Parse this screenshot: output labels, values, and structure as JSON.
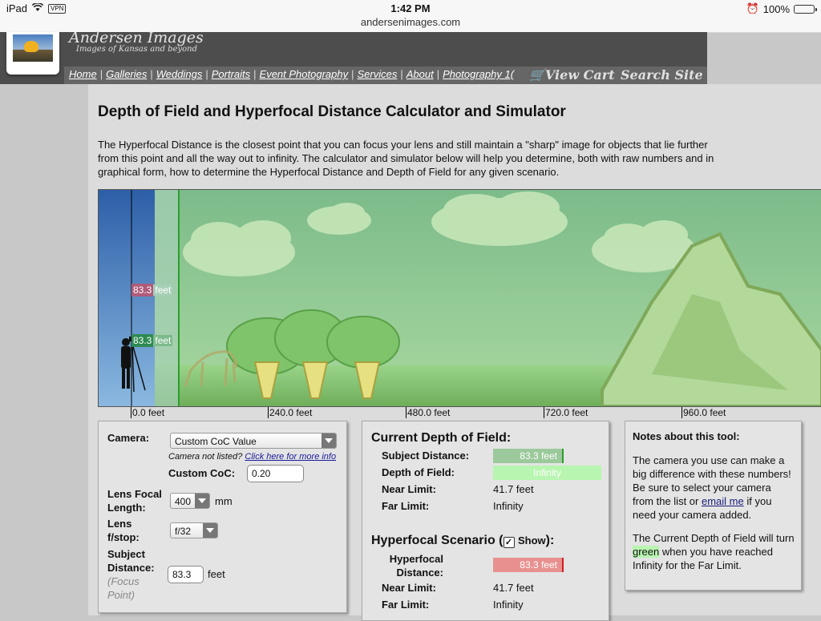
{
  "status_bar": {
    "device": "iPad",
    "vpn": "VPN",
    "time": "1:42 PM",
    "url": "andersenimages.com",
    "battery": "100%"
  },
  "header": {
    "site_title": "Andersen Images",
    "tagline": "Images of Kansas and beyond",
    "nav": [
      "Home",
      "Galleries",
      "Weddings",
      "Portraits",
      "Event Photography",
      "Services",
      "About",
      "Photography 1("
    ],
    "view_cart": "View Cart",
    "search_site": "Search Site"
  },
  "page": {
    "title": "Depth of Field and Hyperfocal Distance Calculator and Simulator",
    "intro": "The Hyperfocal Distance is the closest point that you can focus your lens and still maintain a \"sharp\" image for objects that lie further from this point and all the way out to infinity. The calculator and simulator below will help you determine, both with raw numbers and in graphical form, how to determine the Hyperfocal Distance and Depth of Field for any given scenario."
  },
  "simulator": {
    "hyperfocal_label": {
      "value": "83.3",
      "unit": "feet"
    },
    "subject_label": {
      "value": "83.3",
      "unit": "feet"
    },
    "ticks": [
      "0.0 feet",
      "240.0 feet",
      "480.0 feet",
      "720.0 feet",
      "960.0 feet"
    ]
  },
  "camera_panel": {
    "camera_label": "Camera:",
    "camera_value": "Custom CoC Value",
    "not_listed": "Camera not listed?",
    "more_info_link": "Click here for more info",
    "coc_label": "Custom CoC:",
    "coc_value": "0.20",
    "focal_label": "Lens Focal Length:",
    "focal_value": "400",
    "focal_unit": "mm",
    "fstop_label": "Lens f/stop:",
    "fstop_value": "f/32",
    "subject_label": "Subject Distance:",
    "subject_hint": "(Focus Point)",
    "subject_value": "83.3",
    "subject_unit": "feet"
  },
  "dof_panel": {
    "title": "Current Depth of Field:",
    "subject_distance_label": "Subject Distance:",
    "subject_distance_value": "83.3 feet",
    "dof_label": "Depth of Field:",
    "dof_value": "Infinity",
    "near_label": "Near Limit:",
    "near_value": "41.7 feet",
    "far_label": "Far Limit:",
    "far_value": "Infinity",
    "hyper_title_a": "Hyperfocal Scenario (",
    "hyper_show": "Show",
    "hyper_title_b": "):",
    "hyper_label": "Hyperfocal Distance:",
    "hyper_value": "83.3 feet",
    "hyper_near_label": "Near Limit:",
    "hyper_near_value": "41.7 feet",
    "hyper_far_label": "Far Limit:",
    "hyper_far_value": "Infinity"
  },
  "notes_panel": {
    "title": "Notes about this tool:",
    "p1_a": "The camera you use can make a big difference with these numbers! Be sure to select your camera from the list or",
    "p1_link": "email me",
    "p1_b": "if you need your camera added.",
    "p2_a": "The Current Depth of Field will turn",
    "p2_green": "green",
    "p2_b": "when you have reached Infinity for the Far Limit."
  },
  "colors": {
    "hyper_bar": "#e89090",
    "subject_bar": "#8fc48f",
    "dof_bar": "#b8f5b0",
    "sky": "#8cc89a"
  }
}
